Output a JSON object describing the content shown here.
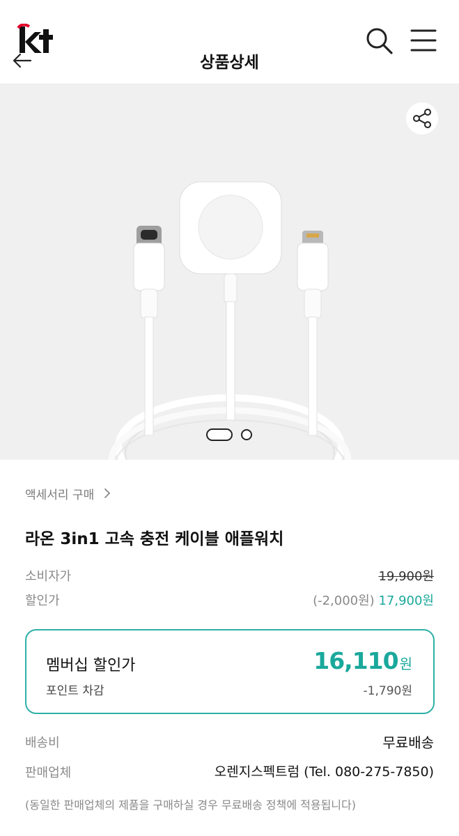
{
  "header": {
    "title": "상품상세",
    "logo_text": "kt"
  },
  "colors": {
    "brand_red": "#e4002b",
    "accent_teal": "#1aa89c",
    "hero_bg": "#f0f0f0"
  },
  "breadcrumb": "액세서리 구매",
  "product": {
    "name": "라온 3in1 고속 충전 케이블 애플워치"
  },
  "pricing": {
    "consumer_label": "소비자가",
    "consumer_price": "19,900원",
    "discount_label": "할인가",
    "discount_amount": "(-2,000원)",
    "discount_price": "17,900원"
  },
  "membership": {
    "title": "멤버십 할인가",
    "price": "16,110",
    "unit": "원",
    "point_label": "포인트 차감",
    "point_value": "-1,790원"
  },
  "shipping": {
    "label": "배송비",
    "value": "무료배송"
  },
  "seller": {
    "label": "판매업체",
    "value": "오렌지스펙트럼 (Tel. 080-275-7850)"
  },
  "note": "(동일한 판매업체의 제품을 구매하실 경우 무료배송 정책에 적용됩니다)",
  "carousel": {
    "current": 1,
    "total": 2
  },
  "icons": [
    "kt-logo",
    "back-arrow-icon",
    "search-icon",
    "menu-icon",
    "share-icon",
    "chevron-right-icon"
  ]
}
